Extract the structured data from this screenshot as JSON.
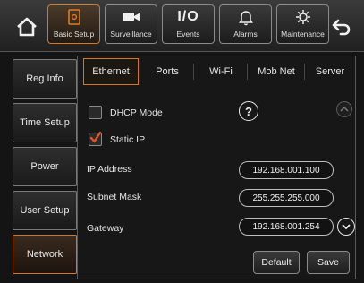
{
  "top_nav": {
    "buttons": [
      {
        "label": "Basic Setup",
        "icon": "settings-page-icon"
      },
      {
        "label": "Surveillance",
        "icon": "camera-icon"
      },
      {
        "label": "Events",
        "icon_text": "I/O"
      },
      {
        "label": "Alarms",
        "icon": "bell-icon"
      },
      {
        "label": "Maintenance",
        "icon": "wrench-gear-icon"
      }
    ]
  },
  "left_nav": {
    "items": [
      "Reg Info",
      "Time Setup",
      "Power",
      "User Setup",
      "Network"
    ]
  },
  "tabs": [
    "Ethernet",
    "Ports",
    "Wi-Fi",
    "Mob Net",
    "Server"
  ],
  "form": {
    "dhcp_label": "DHCP Mode",
    "static_label": "Static IP",
    "ip_label": "IP Address",
    "ip_value": "192.168.001.100",
    "mask_label": "Subnet Mask",
    "mask_value": "255.255.255.000",
    "gateway_label": "Gateway",
    "gateway_value": "192.168.001.254",
    "help_text": "?"
  },
  "actions": {
    "default_label": "Default",
    "save_label": "Save"
  },
  "colors": {
    "accent": "#d9771f",
    "check": "#e0552a"
  }
}
